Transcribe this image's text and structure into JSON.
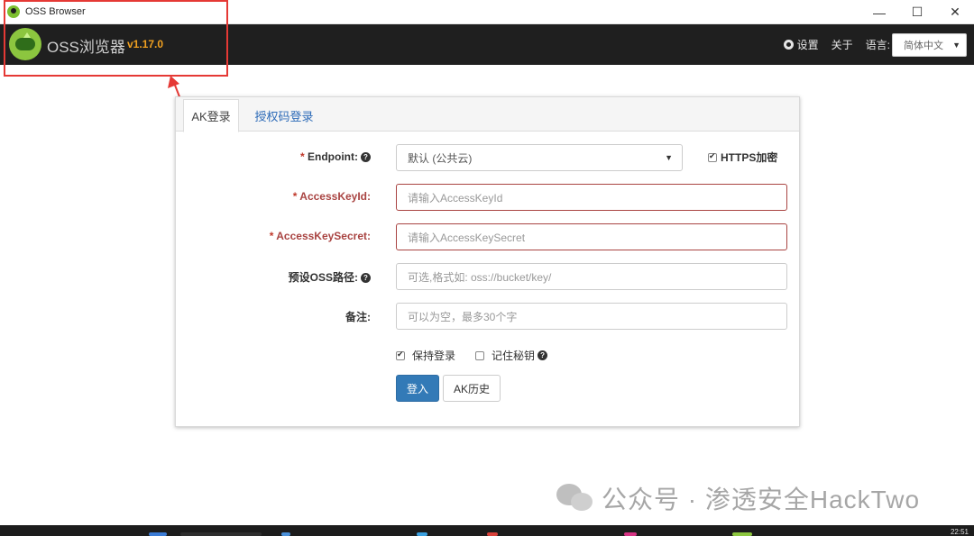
{
  "window": {
    "title": "OSS Browser",
    "controls": {
      "minimize": "—",
      "maximize": "☐",
      "close": "✕"
    }
  },
  "header": {
    "brand": "OSS浏览器",
    "version": "v1.17.0",
    "settings_label": "设置",
    "about_label": "关于",
    "language_label": "语言:",
    "language_value": "简体中文"
  },
  "login": {
    "tabs": [
      {
        "label": "AK登录",
        "active": true
      },
      {
        "label": "授权码登录",
        "active": false
      }
    ],
    "endpoint": {
      "label": "Endpoint:",
      "value": "默认 (公共云)",
      "https_label": "HTTPS加密",
      "https_checked": true
    },
    "access_key_id": {
      "label": "AccessKeyId:",
      "placeholder": "请输入AccessKeyId"
    },
    "access_key_secret": {
      "label": "AccessKeySecret:",
      "placeholder": "请输入AccessKeySecret"
    },
    "preset_path": {
      "label": "预设OSS路径:",
      "placeholder": "可选,格式如: oss://bucket/key/"
    },
    "note": {
      "label": "备注:",
      "placeholder": "可以为空，最多30个字"
    },
    "keep_login": {
      "label": "保持登录",
      "checked": true
    },
    "remember_secret": {
      "label": "记住秘钥",
      "checked": false
    },
    "login_button": "登入",
    "history_button": "AK历史"
  },
  "watermark": "公众号 · 渗透安全HackTwo",
  "taskbar": {
    "clock": "22:51"
  },
  "colors": {
    "app_header_bg": "#1f1f1f",
    "version": "#f0a020",
    "primary_button": "#337ab7",
    "required_label": "#a94442",
    "annotation_red": "#e53935"
  }
}
